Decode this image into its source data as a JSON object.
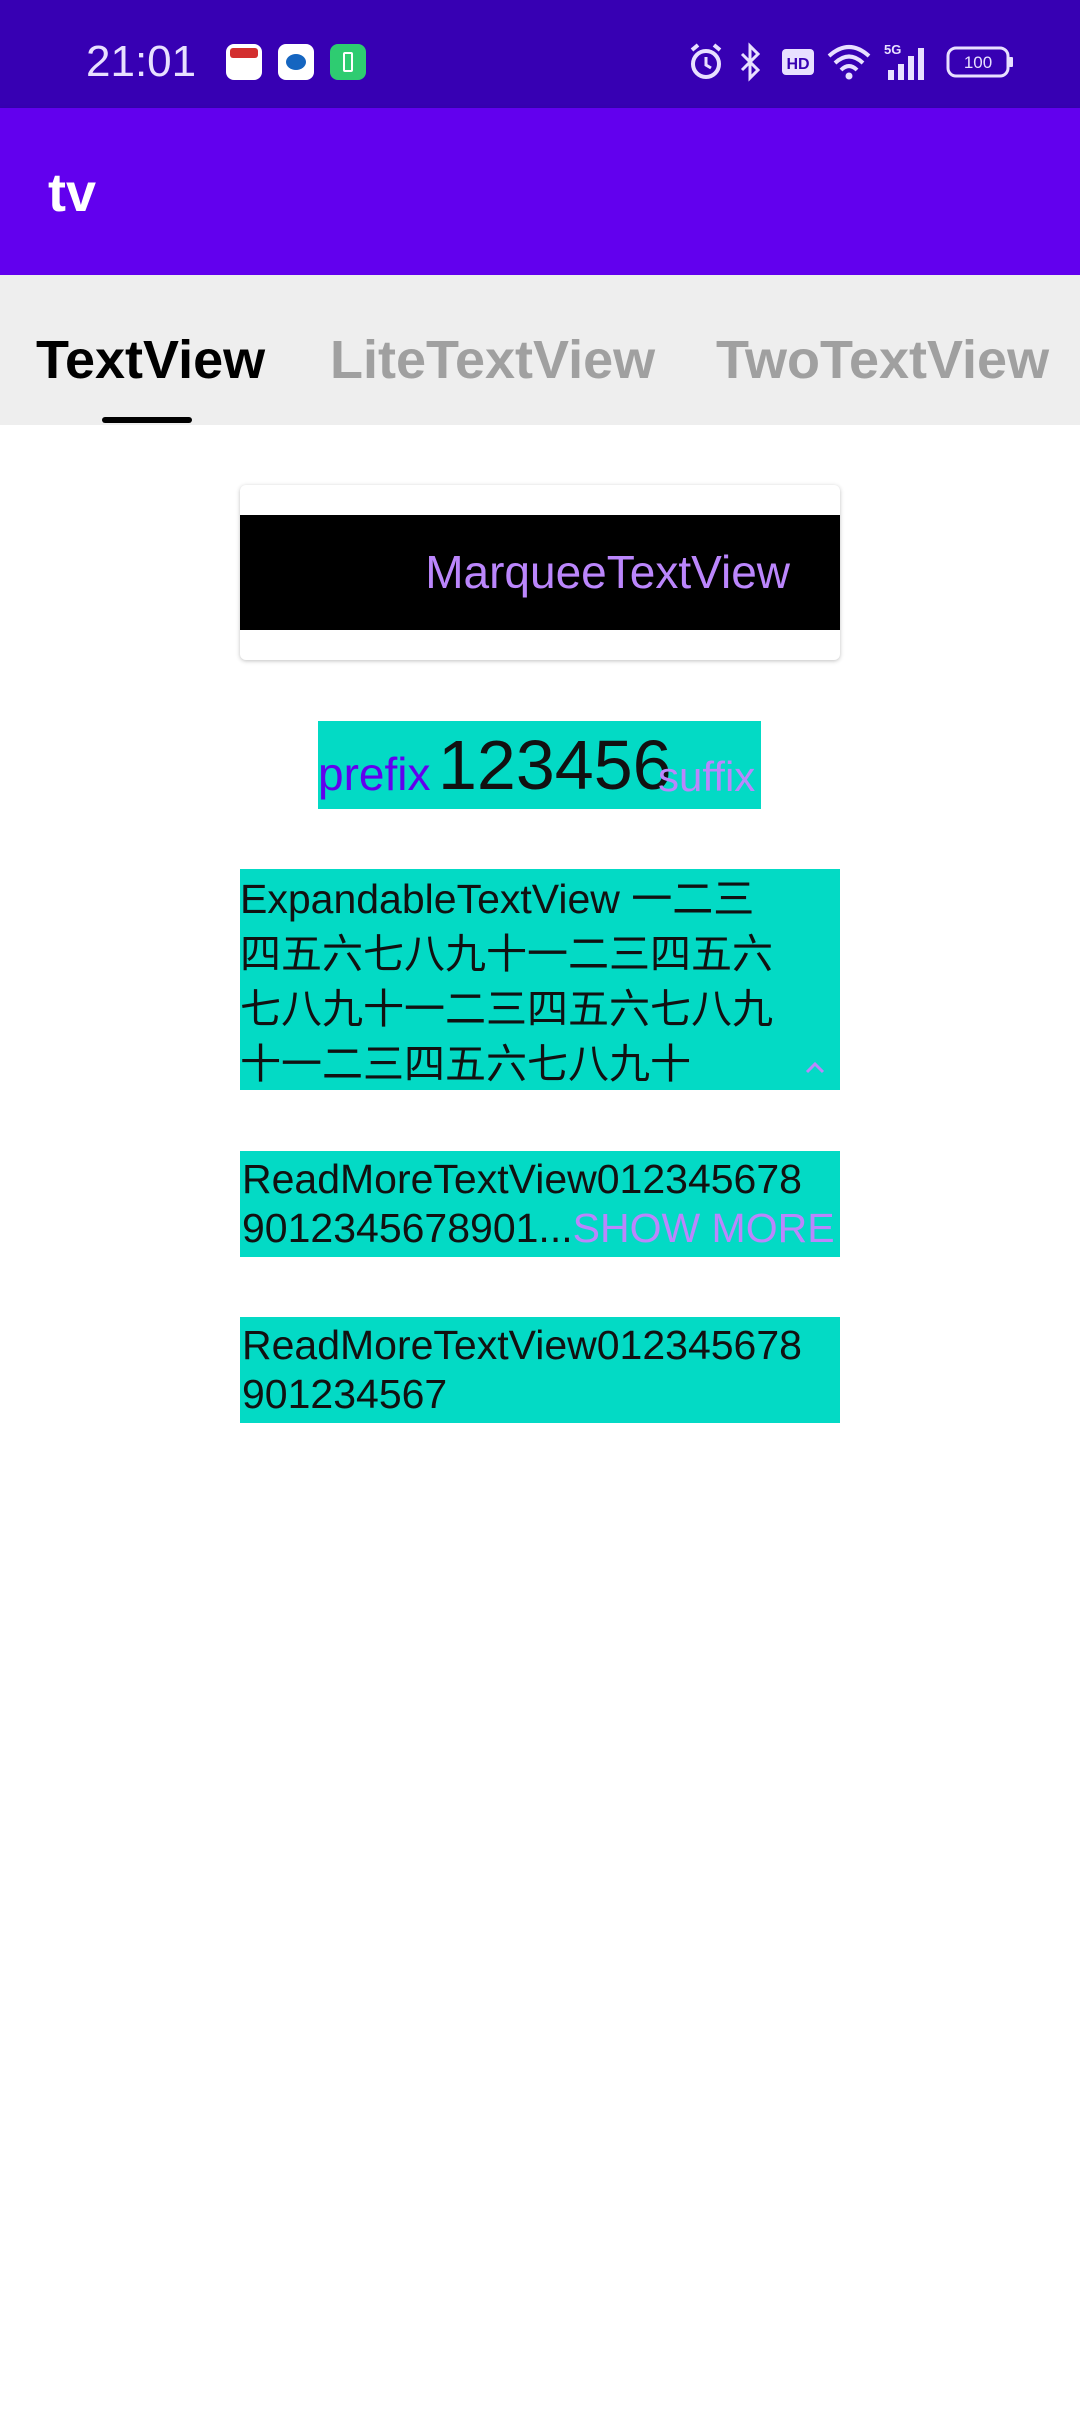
{
  "status_bar": {
    "time": "21:01",
    "notification_icons": [
      "calendar-app-icon",
      "bird-app-icon",
      "battery-saver-app-icon"
    ],
    "system_icons": [
      "alarm-icon",
      "bluetooth-icon",
      "hd-icon",
      "wifi-icon",
      "5g-signal-icon",
      "battery-icon"
    ],
    "network": "5G",
    "hd_label": "HD",
    "battery": "100"
  },
  "app_bar": {
    "title": "tv",
    "color": "#6200ee",
    "status_color": "#3700b3"
  },
  "tabs": [
    {
      "label": "TextView",
      "selected": true
    },
    {
      "label": "LiteTextView",
      "selected": false
    },
    {
      "label": "TwoTextView",
      "selected": false
    }
  ],
  "content": {
    "marquee": {
      "text": "MarqueeTextView",
      "text_color": "#bb86fc",
      "bg_color": "#000000"
    },
    "prefix_suffix": {
      "prefix": "prefix",
      "number": "123456",
      "suffix": "suffix",
      "bg_color": "#03dac5"
    },
    "expandable": {
      "lines": [
        "ExpandableTextView 一二三",
        "四五六七八九十一二三四五六",
        "七八九十一二三四五六七八九",
        "十一二三四五六七八九十"
      ],
      "toggle_icon": "chevron-up-icon"
    },
    "readmore_collapsed": {
      "line1": "ReadMoreTextView012345678",
      "line2": "9012345678901...",
      "show_more": "SHOW MORE"
    },
    "readmore_full": {
      "line1": "ReadMoreTextView012345678",
      "line2": "901234567"
    }
  }
}
